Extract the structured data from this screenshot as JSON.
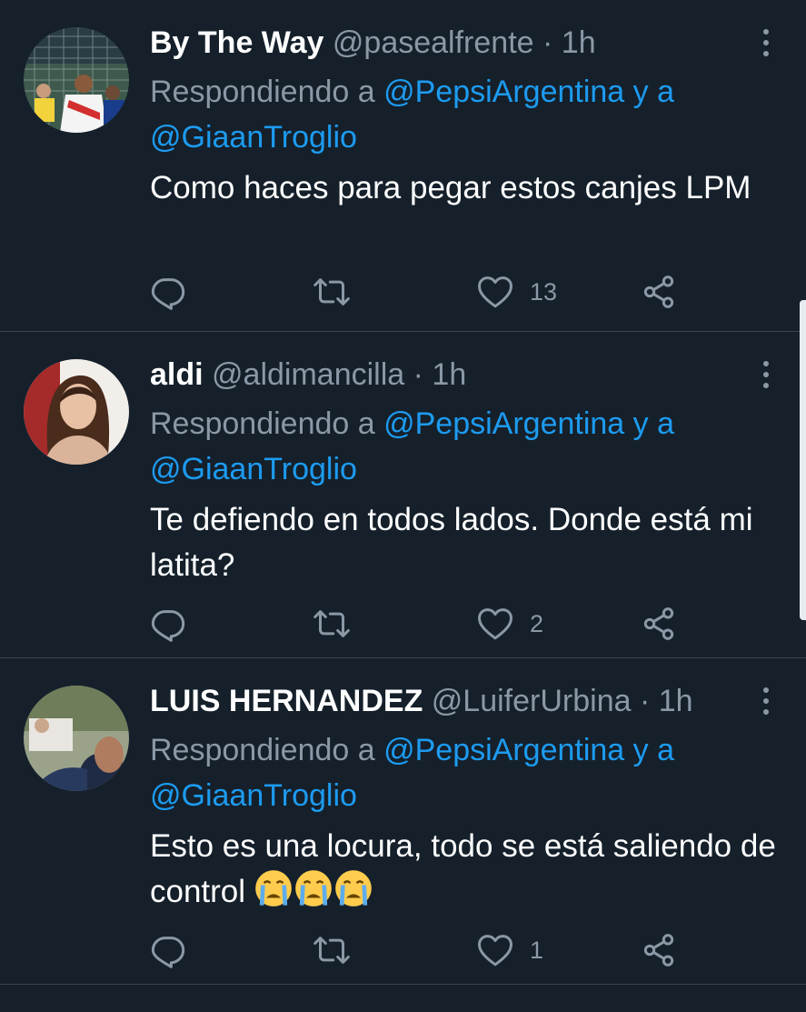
{
  "tweets": [
    {
      "name": "By The Way",
      "handle": "@pasealfrente",
      "separator": "·",
      "time": "1h",
      "replying_prefix": "Respondiendo a ",
      "mention1": "@PepsiArgentina",
      "connector": " y a",
      "mention2": "@GiaanTroglio",
      "text": "Como haces para pegar estos canjes LPM",
      "likes": "13"
    },
    {
      "name": "aldi",
      "handle": "@aldimancilla",
      "separator": "·",
      "time": "1h",
      "replying_prefix": "Respondiendo a ",
      "mention1": "@PepsiArgentina",
      "connector": " y a",
      "mention2": "@GiaanTroglio",
      "text": "Te defiendo en todos lados. Donde está mi latita?",
      "likes": "2"
    },
    {
      "name": "LUIS HERNANDEZ",
      "handle": "@LuiferUrbina",
      "separator": "·",
      "time": "1h",
      "replying_prefix": "Respondiendo a ",
      "mention1": "@PepsiArgentina",
      "connector": " y a",
      "mention2": "@GiaanTroglio",
      "text": "Esto es una locura, todo se está saliendo de control",
      "emojis": [
        "😭",
        "😭",
        "😭"
      ],
      "likes": "1"
    }
  ],
  "icons": {
    "reply": "reply-icon",
    "retweet": "retweet-icon",
    "like": "heart-icon",
    "share": "share-icon",
    "more": "more-icon"
  },
  "colors": {
    "background": "#15202b",
    "text": "#ffffff",
    "secondary": "#8b98a5",
    "link": "#1d9bf0",
    "divider": "#38444d"
  }
}
